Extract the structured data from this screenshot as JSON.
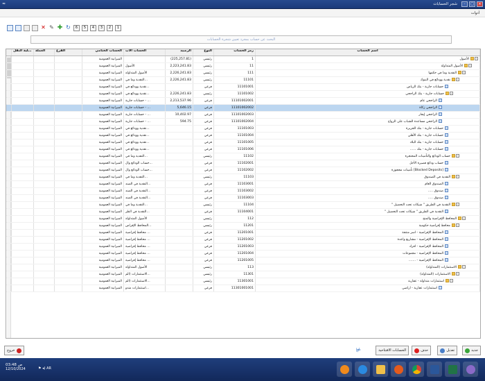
{
  "window": {
    "title": "شجر الحسابات",
    "left_glyph": "≈"
  },
  "menubar": {
    "label": "أدوات"
  },
  "toolbar": {
    "pages": [
      "1",
      "2",
      "3",
      "4",
      "5",
      "6"
    ]
  },
  "search": {
    "placeholder": "البحث عن حساب بمجرد تعيين شجرة الحسابات"
  },
  "grid": {
    "columns": {
      "name": "اسم الحساب",
      "code": "رمز الحساب",
      "type": "النوع",
      "balance": "الرصيد",
      "parent": "الحساب الأب",
      "final": "الحساب الختامي",
      "branch": "الفرع",
      "cur": "العملة",
      "dl": "قابلية النقل"
    },
    "rows": [
      {
        "name": "الأصول",
        "code": "1",
        "type": "رئيسي",
        "balance": "(225,257.81)",
        "parent": "",
        "final": "الميزانية العمومية",
        "lvl": 0,
        "ico": "folder",
        "ex": "-"
      },
      {
        "name": "الأصول المتداولة",
        "code": "11",
        "type": "رئيسي",
        "balance": "2,223,241.83",
        "parent": "الأصول",
        "final": "الميزانية العمومية",
        "lvl": 1,
        "ico": "folder",
        "ex": "-"
      },
      {
        "name": "النقدية وما في حكمها",
        "code": "111",
        "type": "رئيسي",
        "balance": "2,226,241.83",
        "parent": "الأصول المتداولة",
        "final": "الميزانية العمومية",
        "lvl": 2,
        "ico": "folder",
        "ex": "-"
      },
      {
        "name": "نقدية وودائع في البنوك",
        "code": "11101",
        "type": "رئيسي",
        "balance": "2,226,241.83",
        "parent": "النقدية وما في...",
        "final": "الميزانية العمومية",
        "lvl": 3,
        "ico": "folder",
        "ex": "-"
      },
      {
        "name": "حسابات جارية - بنك الرياض",
        "code": "11101001",
        "type": "فرعي",
        "balance": "",
        "parent": "نقدية وودائع في...",
        "final": "الميزانية العمومية",
        "lvl": 4,
        "ico": "doc",
        "ex": ""
      },
      {
        "name": "حسابات جارية - بنك الراجحي",
        "code": "11101002",
        "type": "رئيسي",
        "balance": "2,226,241.83",
        "parent": "نقدية وودائع في...",
        "final": "الميزانية العمومية",
        "lvl": 4,
        "ico": "folder",
        "ex": "-"
      },
      {
        "name": "الراجحي عام",
        "code": "11101002001",
        "type": "فرعي",
        "balance": "2,213,537.96",
        "parent": "حسابات جارية - ...",
        "final": "الميزانية العمومية",
        "lvl": 5,
        "ico": "doc",
        "ex": ""
      },
      {
        "name": "الراجحي زكاة",
        "code": "11101002002",
        "type": "فرعي",
        "balance": "5,646.15",
        "parent": "حسابات جارية - ...",
        "final": "الميزانية العمومية",
        "lvl": 5,
        "ico": "doc",
        "ex": "",
        "sel": true
      },
      {
        "name": "الراجحي إيجار",
        "code": "11101002003",
        "type": "فرعي",
        "balance": "10,402.97",
        "parent": "حسابات جارية - ...",
        "final": "الميزانية العمومية",
        "lvl": 5,
        "ico": "doc",
        "ex": ""
      },
      {
        "name": "الراجحي مساعدة الشباب على الزواج",
        "code": "11101002004",
        "type": "فرعي",
        "balance": "594.75",
        "parent": "حسابات جارية - ...",
        "final": "الميزانية العمومية",
        "lvl": 5,
        "ico": "doc",
        "ex": ""
      },
      {
        "name": "حسابات جارية - بنك الجزيرة",
        "code": "11101003",
        "type": "فرعي",
        "balance": "",
        "parent": "نقدية وودائع في...",
        "final": "الميزانية العمومية",
        "lvl": 4,
        "ico": "doc",
        "ex": ""
      },
      {
        "name": "حسابات جارية - بنك الأهلي",
        "code": "11101004",
        "type": "فرعي",
        "balance": "",
        "parent": "نقدية وودائع في...",
        "final": "الميزانية العمومية",
        "lvl": 4,
        "ico": "doc",
        "ex": ""
      },
      {
        "name": "حسابات جارية - بنك البلاد",
        "code": "11101005",
        "type": "فرعي",
        "balance": "",
        "parent": "نقدية وودائع في...",
        "final": "الميزانية العمومية",
        "lvl": 4,
        "ico": "doc",
        "ex": ""
      },
      {
        "name": "حسابات جارية - بنك ......",
        "code": "11101006",
        "type": "فرعي",
        "balance": "",
        "parent": "نقدية وودائع في...",
        "final": "الميزانية العمومية",
        "lvl": 4,
        "ico": "doc",
        "ex": ""
      },
      {
        "name": "حساب الودائع والتأمينات المحتجزة",
        "code": "11102",
        "type": "رئيسي",
        "balance": "",
        "parent": "النقدية وما في...",
        "final": "الميزانية العمومية",
        "lvl": 3,
        "ico": "folder",
        "ex": "-"
      },
      {
        "name": "حساب ودائع قصيرة الأجل",
        "code": "11102001",
        "type": "فرعي",
        "balance": "",
        "parent": "حساب الودائع وال...",
        "final": "الميزانية العمومية",
        "lvl": 4,
        "ico": "doc",
        "ex": ""
      },
      {
        "name": "[Blocked Deposits] تأمينات محجوزة",
        "code": "11102002",
        "type": "فرعي",
        "balance": "",
        "parent": "حساب الودائع وال...",
        "final": "الميزانية العمومية",
        "lvl": 4,
        "ico": "doc",
        "ex": ""
      },
      {
        "name": "النقدية في الصندوق",
        "code": "11103",
        "type": "رئيسي",
        "balance": "",
        "parent": "النقدية وما في...",
        "final": "الميزانية العمومية",
        "lvl": 3,
        "ico": "folder",
        "ex": "-"
      },
      {
        "name": "الصندوق العام",
        "code": "11103001",
        "type": "فرعي",
        "balance": "",
        "parent": "النقدية في الصند...",
        "final": "الميزانية العمومية",
        "lvl": 4,
        "ico": "doc",
        "ex": ""
      },
      {
        "name": "صندوق .....",
        "code": "11103002",
        "type": "فرعي",
        "balance": "",
        "parent": "النقدية في الصند...",
        "final": "الميزانية العمومية",
        "lvl": 4,
        "ico": "doc",
        "ex": ""
      },
      {
        "name": "صندوق .....",
        "code": "11103003",
        "type": "فرعي",
        "balance": "",
        "parent": "النقدية في الصند...",
        "final": "الميزانية العمومية",
        "lvl": 4,
        "ico": "doc",
        "ex": ""
      },
      {
        "name": "النقدية في الطريق \" شيكات تحت التحصيل \"",
        "code": "11104",
        "type": "رئيسي",
        "balance": "",
        "parent": "النقدية وما في...",
        "final": "الميزانية العمومية",
        "lvl": 3,
        "ico": "folder",
        "ex": "-"
      },
      {
        "name": "النقدية في الطريق \" شيكات تحت التحصيل \"",
        "code": "11104001",
        "type": "فرعي",
        "balance": "",
        "parent": "النقدية في الطر...",
        "final": "الميزانية العمومية",
        "lvl": 4,
        "ico": "doc",
        "ex": ""
      },
      {
        "name": "المحافظ الإقراضية والمنح",
        "code": "112",
        "type": "رئيسي",
        "balance": "",
        "parent": "الأصول المتداولة",
        "final": "الميزانية العمومية",
        "lvl": 2,
        "ico": "folder",
        "ex": "-"
      },
      {
        "name": "محافظ إقراضية حكومية",
        "code": "11201",
        "type": "رئيسي",
        "balance": "",
        "parent": "المحافظ الإقراض...",
        "final": "الميزانية العمومية",
        "lvl": 3,
        "ico": "folder",
        "ex": "-"
      },
      {
        "name": "المحافظ الإقراضية - اسر منتجة",
        "code": "11201001",
        "type": "فرعي",
        "balance": "",
        "parent": "محافظ إقراضية ...",
        "final": "الميزانية العمومية",
        "lvl": 4,
        "ico": "doc",
        "ex": ""
      },
      {
        "name": "المحافظ الإقراضية - مشاريع واعدة",
        "code": "11201002",
        "type": "فرعي",
        "balance": "",
        "parent": "محافظ إقراضية ...",
        "final": "الميزانية العمومية",
        "lvl": 4,
        "ico": "doc",
        "ex": ""
      },
      {
        "name": "المحافظ الإقراضية - افراد",
        "code": "11201003",
        "type": "فرعي",
        "balance": "",
        "parent": "محافظ إقراضية ...",
        "final": "الميزانية العمومية",
        "lvl": 4,
        "ico": "doc",
        "ex": ""
      },
      {
        "name": "المحافظ الإقراضية - مجموعات",
        "code": "11201004",
        "type": "فرعي",
        "balance": "",
        "parent": "محافظ إقراضية ...",
        "final": "الميزانية العمومية",
        "lvl": 4,
        "ico": "doc",
        "ex": ""
      },
      {
        "name": "المحافظ الإقراضية - .......",
        "code": "11201005",
        "type": "فرعي",
        "balance": "",
        "parent": "محافظ إقراضية ...",
        "final": "الميزانية العمومية",
        "lvl": 4,
        "ico": "doc",
        "ex": ""
      },
      {
        "name": "الاستثمارات (المتداولة)",
        "code": "113",
        "type": "رئيسي",
        "balance": "",
        "parent": "الأصول المتداولة",
        "final": "الميزانية العمومية",
        "lvl": 2,
        "ico": "folder",
        "ex": "-"
      },
      {
        "name": "الاستثمارات (المتداولة)",
        "code": "11301",
        "type": "رئيسي",
        "balance": "",
        "parent": "الاستثمارات (الم...",
        "final": "الميزانية العمومية",
        "lvl": 3,
        "ico": "folder",
        "ex": "-"
      },
      {
        "name": "استثمارات متداولة - عقارية",
        "code": "11301001",
        "type": "رئيسي",
        "balance": "",
        "parent": "الاستثمارات (الم...",
        "final": "الميزانية العمومية",
        "lvl": 4,
        "ico": "folder",
        "ex": "-"
      },
      {
        "name": "استثمارات عقارية - اراضي",
        "code": "11301001001",
        "type": "فرعي",
        "balance": "",
        "parent": "استثمارات متدو...",
        "final": "الميزانية العمومية",
        "lvl": 5,
        "ico": "doc",
        "ex": ""
      }
    ]
  },
  "bottom": {
    "new": "جديد",
    "edit": "تعديل",
    "delete": "حذف",
    "opening": "الحسابات الافتتاحية",
    "exit": "خروج"
  },
  "taskbar": {
    "time": "03:48 ص",
    "date": "12/10/2024",
    "lang": "AR"
  }
}
